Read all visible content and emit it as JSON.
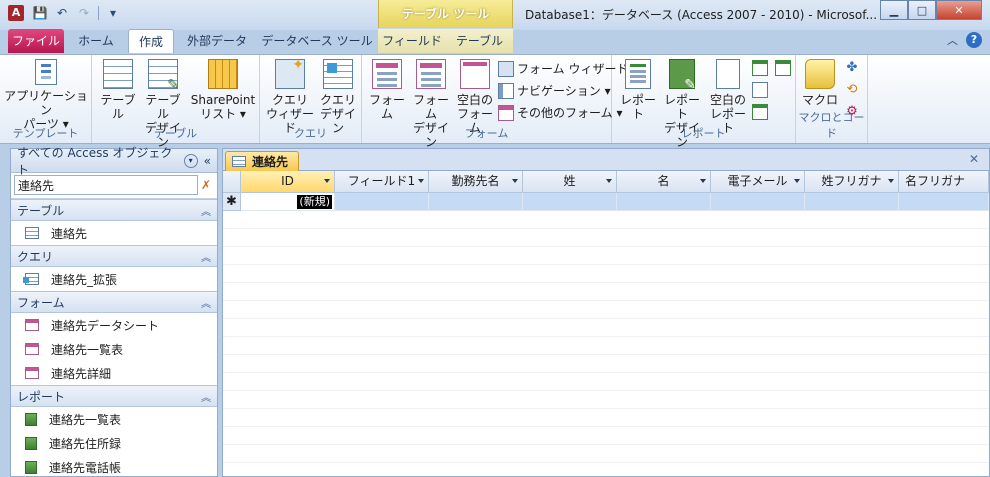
{
  "app": {
    "icon_letter": "A",
    "window_title": "Database1：データベース (Access 2007 - 2010) - Microsof...",
    "context_tab_header": "テーブル ツール"
  },
  "tabs": {
    "file": "ファイル",
    "home": "ホーム",
    "create": "作成",
    "external": "外部データ",
    "dbtools": "データベース ツール",
    "fields": "フィールド",
    "table": "テーブル"
  },
  "ribbon": {
    "templates": {
      "app_parts": "アプリケーション\nパーツ ▾",
      "label": "テンプレート"
    },
    "tables": {
      "table": "テーブル",
      "table_design": "テーブル\nデザイン",
      "sharepoint": "SharePoint\nリスト ▾",
      "label": "テーブル"
    },
    "queries": {
      "wizard": "クエリ\nウィザード",
      "design": "クエリ\nデザイン",
      "label": "クエリ"
    },
    "forms": {
      "form": "フォーム",
      "form_design": "フォーム\nデザイン",
      "blank_form": "空白の\nフォーム",
      "form_wizard": "フォーム ウィザード",
      "navigation": "ナビゲーション ▾",
      "more_forms": "その他のフォーム ▾",
      "label": "フォーム"
    },
    "reports": {
      "report": "レポート",
      "report_design": "レポート\nデザイン",
      "blank_report": "空白の\nレポート",
      "label": "レポート"
    },
    "macros": {
      "macro": "マクロ",
      "label": "マクロとコード"
    }
  },
  "nav": {
    "title": "すべての Access オブジェクト",
    "search_value": "連絡先",
    "groups": [
      {
        "label": "テーブル",
        "items": [
          "連絡先"
        ]
      },
      {
        "label": "クエリ",
        "items": [
          "連絡先_拡張"
        ]
      },
      {
        "label": "フォーム",
        "items": [
          "連絡先データシート",
          "連絡先一覧表",
          "連絡先詳細"
        ]
      },
      {
        "label": "レポート",
        "items": [
          "連絡先一覧表",
          "連絡先住所録",
          "連絡先電話帳"
        ]
      }
    ]
  },
  "document": {
    "tab_title": "連絡先",
    "columns": [
      "ID",
      "フィールド1",
      "勤務先名",
      "姓",
      "名",
      "電子メール",
      "姓フリガナ",
      "名フリガナ"
    ],
    "new_record_marker": "✱",
    "new_record_label": "(新規)"
  }
}
